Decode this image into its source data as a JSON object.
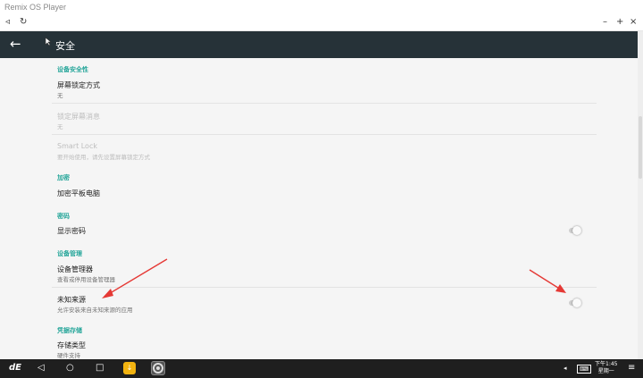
{
  "window": {
    "title": "Remix OS Player"
  },
  "appbar": {
    "title": "安全"
  },
  "settings": {
    "sec_device": "设备安全性",
    "screen_lock_title": "屏幕锁定方式",
    "screen_lock_value": "无",
    "lock_msg_title": "锁定屏幕消息",
    "lock_msg_value": "无",
    "smart_lock_title": "Smart Lock",
    "smart_lock_sub": "要开始使用，请先设置屏幕锁定方式",
    "sec_encrypt": "加密",
    "encrypt_title": "加密平板电脑",
    "sec_password": "密码",
    "show_password_title": "显示密码",
    "sec_device_admin": "设备管理",
    "device_admin_title": "设备管理器",
    "device_admin_sub": "查看或停用设备管理器",
    "unknown_sources_title": "未知来源",
    "unknown_sources_sub": "允许安装来自未知来源的应用",
    "sec_credentials": "凭据存储",
    "storage_type_title": "存储类型",
    "storage_type_value": "硬件支持"
  },
  "toggles": {
    "show_password": false,
    "unknown_sources": false
  },
  "clock": {
    "time": "下午1:45",
    "day": "星期一"
  },
  "colors": {
    "accent": "#26a69a",
    "appbar": "#263238",
    "annotation_arrow": "#e53935"
  },
  "icons": {
    "back": "arrow-left-icon",
    "min": "minus-icon",
    "add": "plus-icon",
    "close": "close-icon",
    "logo": "remix-logo-icon",
    "nav_back": "triangle-back-icon",
    "home": "circle-home-icon",
    "recent": "square-recents-icon"
  }
}
